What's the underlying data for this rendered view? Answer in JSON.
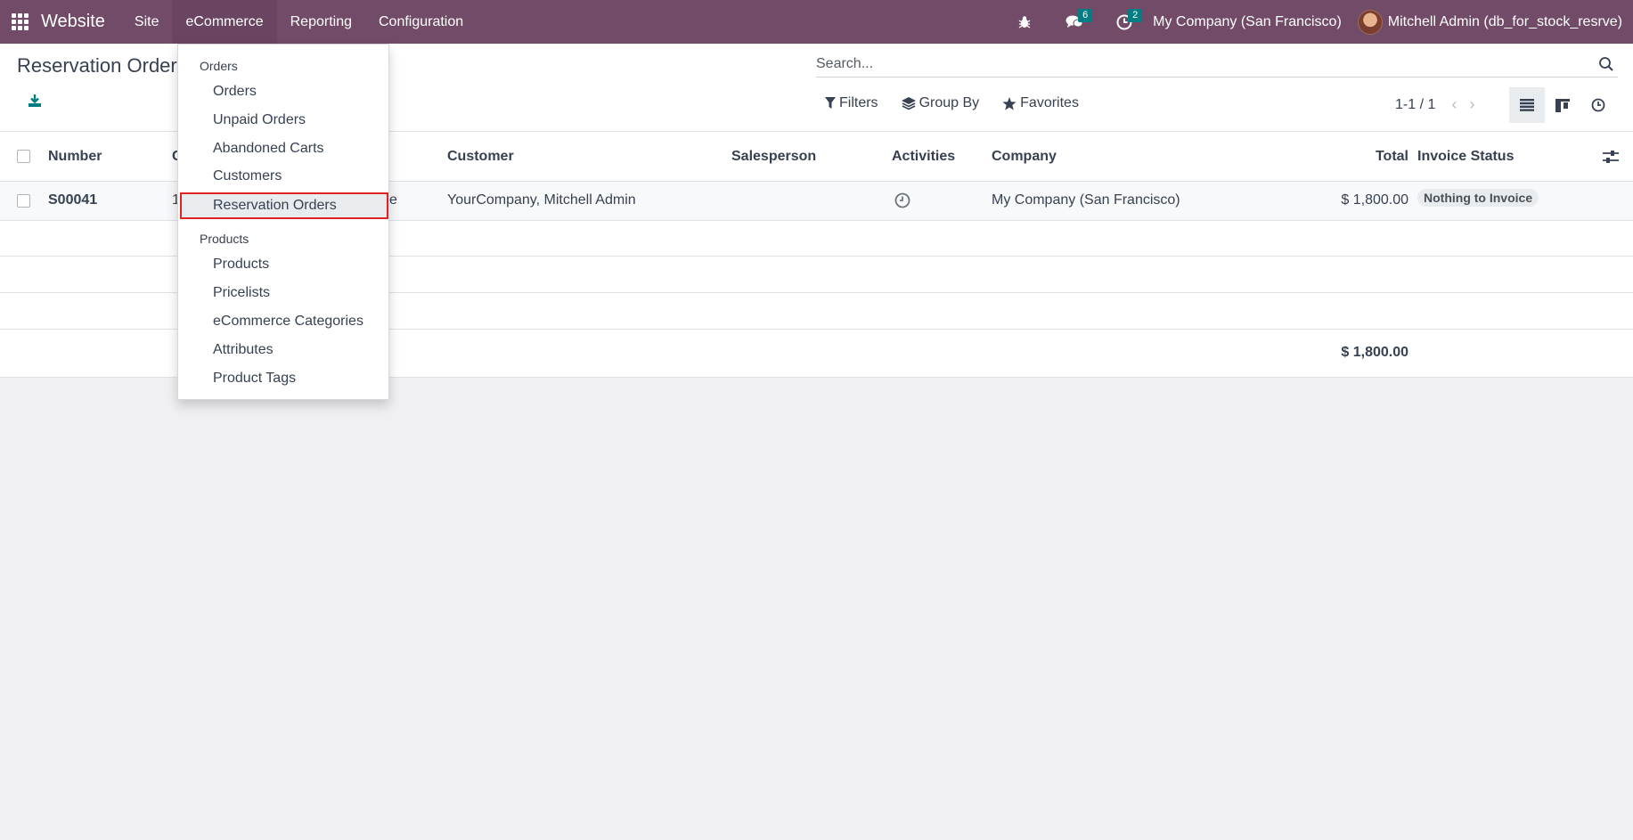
{
  "navbar": {
    "brand": "Website",
    "menus": [
      "Site",
      "eCommerce",
      "Reporting",
      "Configuration"
    ],
    "messages_badge": "6",
    "activities_badge": "2",
    "company": "My Company (San Francisco)",
    "user": "Mitchell Admin (db_for_stock_resrve)"
  },
  "control": {
    "title": "Reservation Orders",
    "search_placeholder": "Search...",
    "filters_label": "Filters",
    "groupby_label": "Group By",
    "favorites_label": "Favorites",
    "pager": "1-1 / 1"
  },
  "table": {
    "headers": {
      "number": "Number",
      "customer": "Customer",
      "salesperson": "Salesperson",
      "activities": "Activities",
      "company": "Company",
      "total": "Total",
      "invoice_status": "Invoice Status"
    },
    "header_partial": "C",
    "row": {
      "number": "S00041",
      "partial_left": "1",
      "partial_mid": "e",
      "customer": "YourCompany, Mitchell Admin",
      "company": "My Company (San Francisco)",
      "total": "$ 1,800.00",
      "invoice_status": "Nothing to Invoice"
    },
    "sum_total": "$ 1,800.00"
  },
  "dropdown": {
    "section_orders": "Orders",
    "orders_items": [
      "Orders",
      "Unpaid Orders",
      "Abandoned Carts",
      "Customers",
      "Reservation Orders"
    ],
    "section_products": "Products",
    "products_items": [
      "Products",
      "Pricelists",
      "eCommerce Categories",
      "Attributes",
      "Product Tags"
    ],
    "selected_item": "Reservation Orders"
  },
  "colors": {
    "navbar": "#714b67",
    "badge": "#017e84",
    "highlight_border": "#e02424"
  }
}
